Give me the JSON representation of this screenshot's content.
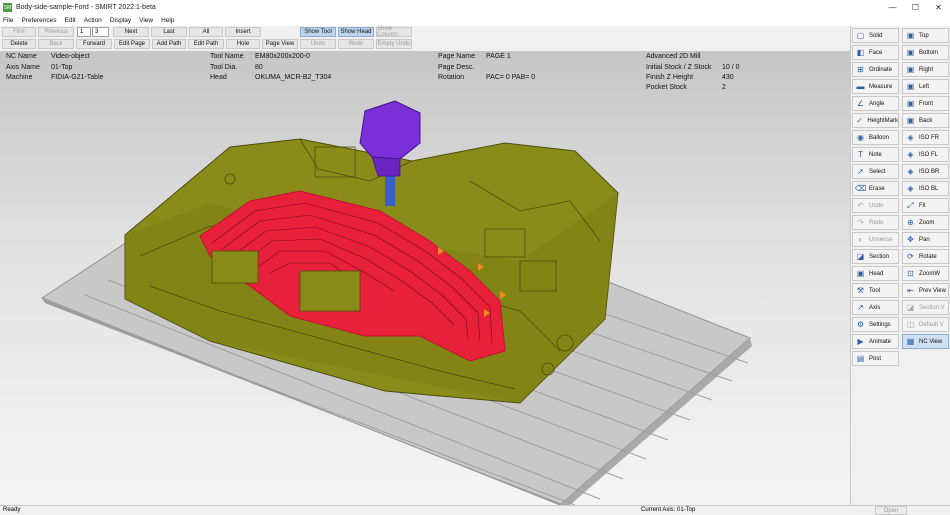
{
  "titlebar": {
    "app_icon": "SM",
    "title": "Body-side-sample-Ford - SMIRT 2022.1-beta",
    "minimize": "—",
    "maximize": "☐",
    "close": "✕"
  },
  "menu": [
    "File",
    "Preferences",
    "Edit",
    "Action",
    "Display",
    "View",
    "Help"
  ],
  "toolbar": {
    "row1": {
      "first": "First",
      "previous": "Previous",
      "current_page": "1",
      "total_pages": "3",
      "next": "Next",
      "last": "Last",
      "all": "All",
      "insert": "Insert",
      "show_tool": "Show Tool",
      "show_head": "Show Head",
      "show_column": "Show Column"
    },
    "row2": {
      "delete": "Delete",
      "back": "Back",
      "forward": "Forward",
      "edit_page": "Edit Page",
      "add_path": "Add Path",
      "edit_path": "Edit Path",
      "hole": "Hole",
      "page_view": "Page View",
      "undo": "Undo",
      "redo": "Redo",
      "empty_undo": "Empty Undo"
    }
  },
  "info": {
    "nc_name_label": "NC Name",
    "nc_name": "Video-object",
    "axis_name_label": "Axis Name",
    "axis_name": "01-Top",
    "machine_label": "Machine",
    "machine": "FIDIA-G21-Table",
    "tool_name_label": "Tool Name",
    "tool_name": "EM80x200x200-0",
    "tool_dia_label": "Tool Dia.",
    "tool_dia": "80",
    "head_label": "Head",
    "head": "OKUMA_MCR-B2_T304",
    "page_name_label": "Page Name",
    "page_name": "PAGE 1",
    "page_desc_label": "Page Desc.",
    "rotation_label": "Rotation",
    "rotation": "PAC= 0  PAB= 0",
    "operation": "Advanced 2D Mill",
    "initial_stock_label": "Initial Stock / Z Stock",
    "initial_stock": "10 / 0",
    "finish_z_label": "Finish Z Height",
    "finish_z": "430",
    "pocket_stock_label": "Pocket Stock",
    "pocket_stock": "2"
  },
  "right_panel": {
    "left": [
      {
        "label": "Solid",
        "icon": "cube-icon",
        "glyph": "▢"
      },
      {
        "label": "Face",
        "icon": "face-icon",
        "glyph": "◧"
      },
      {
        "label": "Ordinate",
        "icon": "ordinate-icon",
        "glyph": "⊞"
      },
      {
        "label": "Measure",
        "icon": "ruler-icon",
        "glyph": "▬"
      },
      {
        "label": "Angle",
        "icon": "angle-icon",
        "glyph": "∠"
      },
      {
        "label": "HeightMark",
        "icon": "check-icon",
        "glyph": "✓"
      },
      {
        "label": "Balloon",
        "icon": "balloon-icon",
        "glyph": "◉"
      },
      {
        "label": "Note",
        "icon": "text-icon",
        "glyph": "T"
      },
      {
        "label": "Select",
        "icon": "cursor-icon",
        "glyph": "➚"
      },
      {
        "label": "Erase",
        "icon": "erase-icon",
        "glyph": "⌫"
      },
      {
        "label": "Undo",
        "icon": "undo-icon",
        "glyph": "↶",
        "disabled": true
      },
      {
        "label": "Redo",
        "icon": "redo-icon",
        "glyph": "↷",
        "disabled": true
      },
      {
        "label": "Unsense",
        "icon": "unsense-icon",
        "glyph": "◐",
        "disabled": true
      },
      {
        "label": "Section",
        "icon": "section-icon",
        "glyph": "◪"
      },
      {
        "label": "Head",
        "icon": "head-icon",
        "glyph": "▣"
      },
      {
        "label": "Tool",
        "icon": "tool-icon",
        "glyph": "⚒"
      },
      {
        "label": "Axis",
        "icon": "axis-icon",
        "glyph": "↗"
      },
      {
        "label": "Settings",
        "icon": "gear-icon",
        "glyph": "⚙"
      },
      {
        "label": "Animate",
        "icon": "animate-icon",
        "glyph": "▶"
      },
      {
        "label": "Post",
        "icon": "post-icon",
        "glyph": "▤"
      }
    ],
    "right": [
      {
        "label": "Top",
        "icon": "view-top-icon",
        "glyph": "▣"
      },
      {
        "label": "Bottom",
        "icon": "view-bottom-icon",
        "glyph": "▣"
      },
      {
        "label": "Right",
        "icon": "view-right-icon",
        "glyph": "▣"
      },
      {
        "label": "Left",
        "icon": "view-left-icon",
        "glyph": "▣"
      },
      {
        "label": "Front",
        "icon": "view-front-icon",
        "glyph": "▣"
      },
      {
        "label": "Back",
        "icon": "view-back-icon",
        "glyph": "▣"
      },
      {
        "label": "ISO FR",
        "icon": "iso-fr-icon",
        "glyph": "◈"
      },
      {
        "label": "ISO FL",
        "icon": "iso-fl-icon",
        "glyph": "◈"
      },
      {
        "label": "ISO BR",
        "icon": "iso-br-icon",
        "glyph": "◈"
      },
      {
        "label": "ISO BL",
        "icon": "iso-bl-icon",
        "glyph": "◈"
      },
      {
        "label": "Fit",
        "icon": "fit-icon",
        "glyph": "⤢"
      },
      {
        "label": "Zoom",
        "icon": "zoom-icon",
        "glyph": "⊕"
      },
      {
        "label": "Pan",
        "icon": "pan-icon",
        "glyph": "✥"
      },
      {
        "label": "Rotate",
        "icon": "rotate-icon",
        "glyph": "⟳"
      },
      {
        "label": "ZoomW",
        "icon": "zoom-window-icon",
        "glyph": "⊡"
      },
      {
        "label": "Prev View",
        "icon": "prev-view-icon",
        "glyph": "⇤"
      },
      {
        "label": "Section V",
        "icon": "section-view-icon",
        "glyph": "◪",
        "disabled": true
      },
      {
        "label": "Default V",
        "icon": "default-view-icon",
        "glyph": "◫",
        "disabled": true
      },
      {
        "label": "NC View",
        "icon": "nc-view-icon",
        "glyph": "▦",
        "active": true
      }
    ]
  },
  "status": {
    "left": "Ready",
    "current_axis": "Current Axis: 01-Top",
    "open": "Open"
  },
  "colors": {
    "part": "#8a8c1a",
    "toolpath": "#e8203a",
    "tool": "#7a2fd8",
    "table": "#c2c2c2"
  }
}
